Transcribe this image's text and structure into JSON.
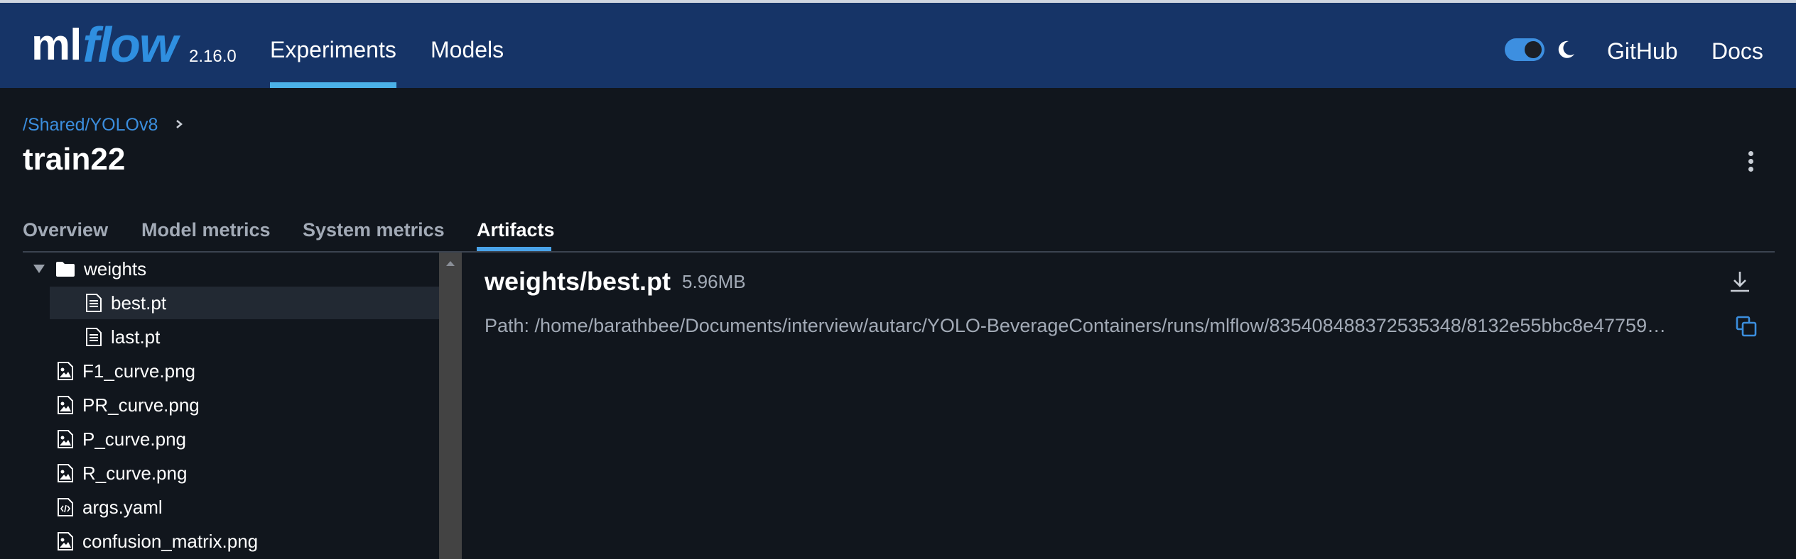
{
  "header": {
    "logo_ml": "ml",
    "logo_flow": "flow",
    "version": "2.16.0",
    "nav": [
      {
        "label": "Experiments",
        "active": true
      },
      {
        "label": "Models",
        "active": false
      }
    ],
    "theme_toggle": {
      "on": true,
      "icon": "moon-icon"
    },
    "links": [
      {
        "label": "GitHub"
      },
      {
        "label": "Docs"
      }
    ]
  },
  "breadcrumb": {
    "path": "/Shared/YOLOv8"
  },
  "page": {
    "title": "train22"
  },
  "tabs": [
    {
      "label": "Overview",
      "active": false
    },
    {
      "label": "Model metrics",
      "active": false
    },
    {
      "label": "System metrics",
      "active": false
    },
    {
      "label": "Artifacts",
      "active": true
    }
  ],
  "tree": {
    "items": [
      {
        "name": "weights",
        "type": "folder",
        "expanded": true
      },
      {
        "name": "best.pt",
        "type": "file",
        "selected": true
      },
      {
        "name": "last.pt",
        "type": "file"
      },
      {
        "name": "F1_curve.png",
        "type": "image"
      },
      {
        "name": "PR_curve.png",
        "type": "image"
      },
      {
        "name": "P_curve.png",
        "type": "image"
      },
      {
        "name": "R_curve.png",
        "type": "image"
      },
      {
        "name": "args.yaml",
        "type": "code"
      },
      {
        "name": "confusion_matrix.png",
        "type": "image"
      }
    ]
  },
  "detail": {
    "title": "weights/best.pt",
    "size": "5.96MB",
    "path": "Path: /home/barathbee/Documents/interview/autarc/YOLO-BeverageContainers/runs/mlflow/835408488372535348/8132e55bbc8e47759…"
  },
  "colors": {
    "header_bg": "#163467",
    "page_bg": "#11161d",
    "accent": "#4bb1e8",
    "link": "#3b8ede",
    "selected_row": "#222933"
  }
}
